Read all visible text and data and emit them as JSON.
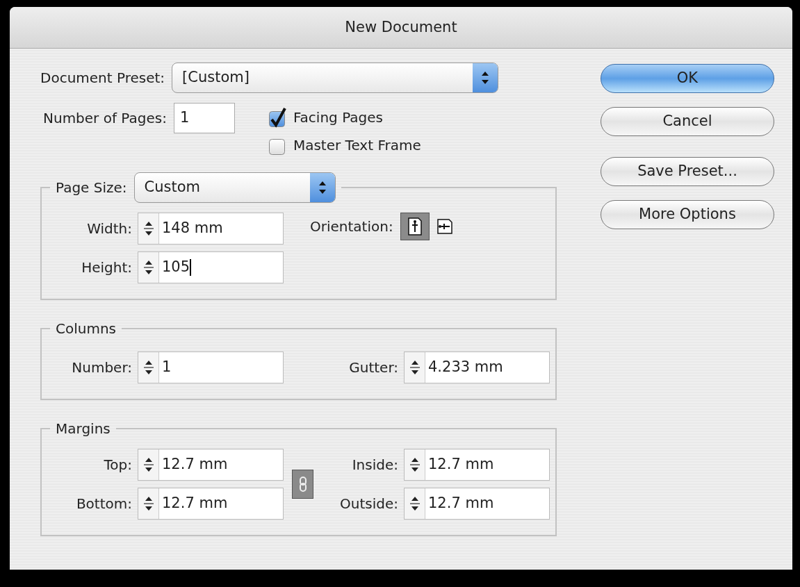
{
  "window": {
    "title": "New Document"
  },
  "preset": {
    "label": "Document Preset:",
    "value": "[Custom]"
  },
  "pages": {
    "label": "Number of Pages:",
    "value": "1"
  },
  "checkboxes": [
    {
      "label": "Facing Pages",
      "checked": true
    },
    {
      "label": "Master Text Frame",
      "checked": false
    }
  ],
  "page_size": {
    "label": "Page Size:",
    "value": "Custom",
    "fields": [
      {
        "label": "Width:",
        "value": "148 mm",
        "focused": false
      },
      {
        "label": "Height:",
        "value": "105",
        "focused": true
      }
    ],
    "orientation": {
      "label": "Orientation:",
      "options": [
        {
          "kind": "portrait",
          "selected": true
        },
        {
          "kind": "landscape",
          "selected": false
        }
      ]
    }
  },
  "columns": {
    "title": "Columns",
    "fields": [
      {
        "label": "Number:",
        "value": "1"
      },
      {
        "label": "Gutter:",
        "value": "4.233 mm"
      }
    ]
  },
  "margins": {
    "title": "Margins",
    "linked": true,
    "left": [
      {
        "label": "Top:",
        "value": "12.7 mm"
      },
      {
        "label": "Bottom:",
        "value": "12.7 mm"
      }
    ],
    "right": [
      {
        "label": "Inside:",
        "value": "12.7 mm"
      },
      {
        "label": "Outside:",
        "value": "12.7 mm"
      }
    ]
  },
  "buttons": [
    {
      "label": "OK",
      "default": true
    },
    {
      "label": "Cancel",
      "default": false
    },
    {
      "label": "Save Preset...",
      "default": false
    },
    {
      "label": "More Options",
      "default": false
    }
  ]
}
